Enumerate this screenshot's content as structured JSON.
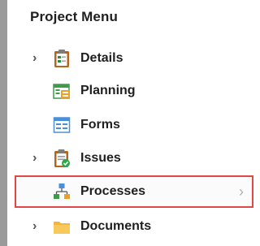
{
  "panel": {
    "title": "Project Menu"
  },
  "menu": {
    "items": [
      {
        "label": "Details",
        "icon": "clipboard-icon",
        "expandable": true,
        "selected": false
      },
      {
        "label": "Planning",
        "icon": "planning-icon",
        "expandable": false,
        "selected": false
      },
      {
        "label": "Forms",
        "icon": "forms-icon",
        "expandable": false,
        "selected": false
      },
      {
        "label": "Issues",
        "icon": "issues-clipboard-icon",
        "expandable": true,
        "selected": false
      },
      {
        "label": "Processes",
        "icon": "hierarchy-icon",
        "expandable": false,
        "selected": true
      },
      {
        "label": "Documents",
        "icon": "folder-icon",
        "expandable": true,
        "selected": false
      }
    ],
    "expander_glyph": "›",
    "chevron_glyph": "›"
  },
  "colors": {
    "selection_border": "#e04848",
    "left_rail": "#9a9a9a",
    "text": "#1f1f1f"
  }
}
